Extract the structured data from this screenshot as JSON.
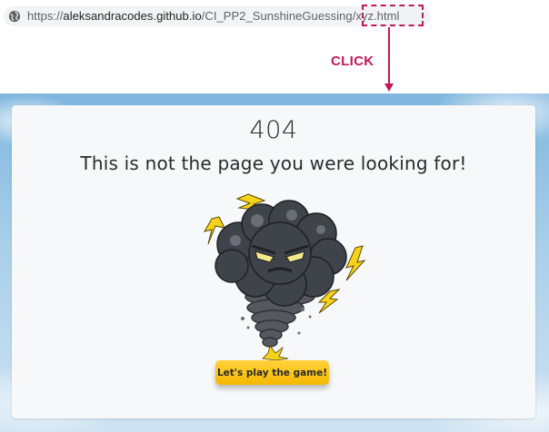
{
  "browser": {
    "url": {
      "scheme": "https://",
      "domain": "aleksandracodes.github.io",
      "path": "/CI_PP2_SunshineGuessing/xyz.html"
    },
    "page_info_icon": "globe-icon"
  },
  "annotation": {
    "label": "CLICK",
    "color": "#c2185b"
  },
  "error_page": {
    "code": "404",
    "message": "This is not the page you were looking for!",
    "illustration": "storm-cloud-tornado-icon",
    "button_label": "Let's play the game!",
    "button_color": "#f9c41c"
  }
}
